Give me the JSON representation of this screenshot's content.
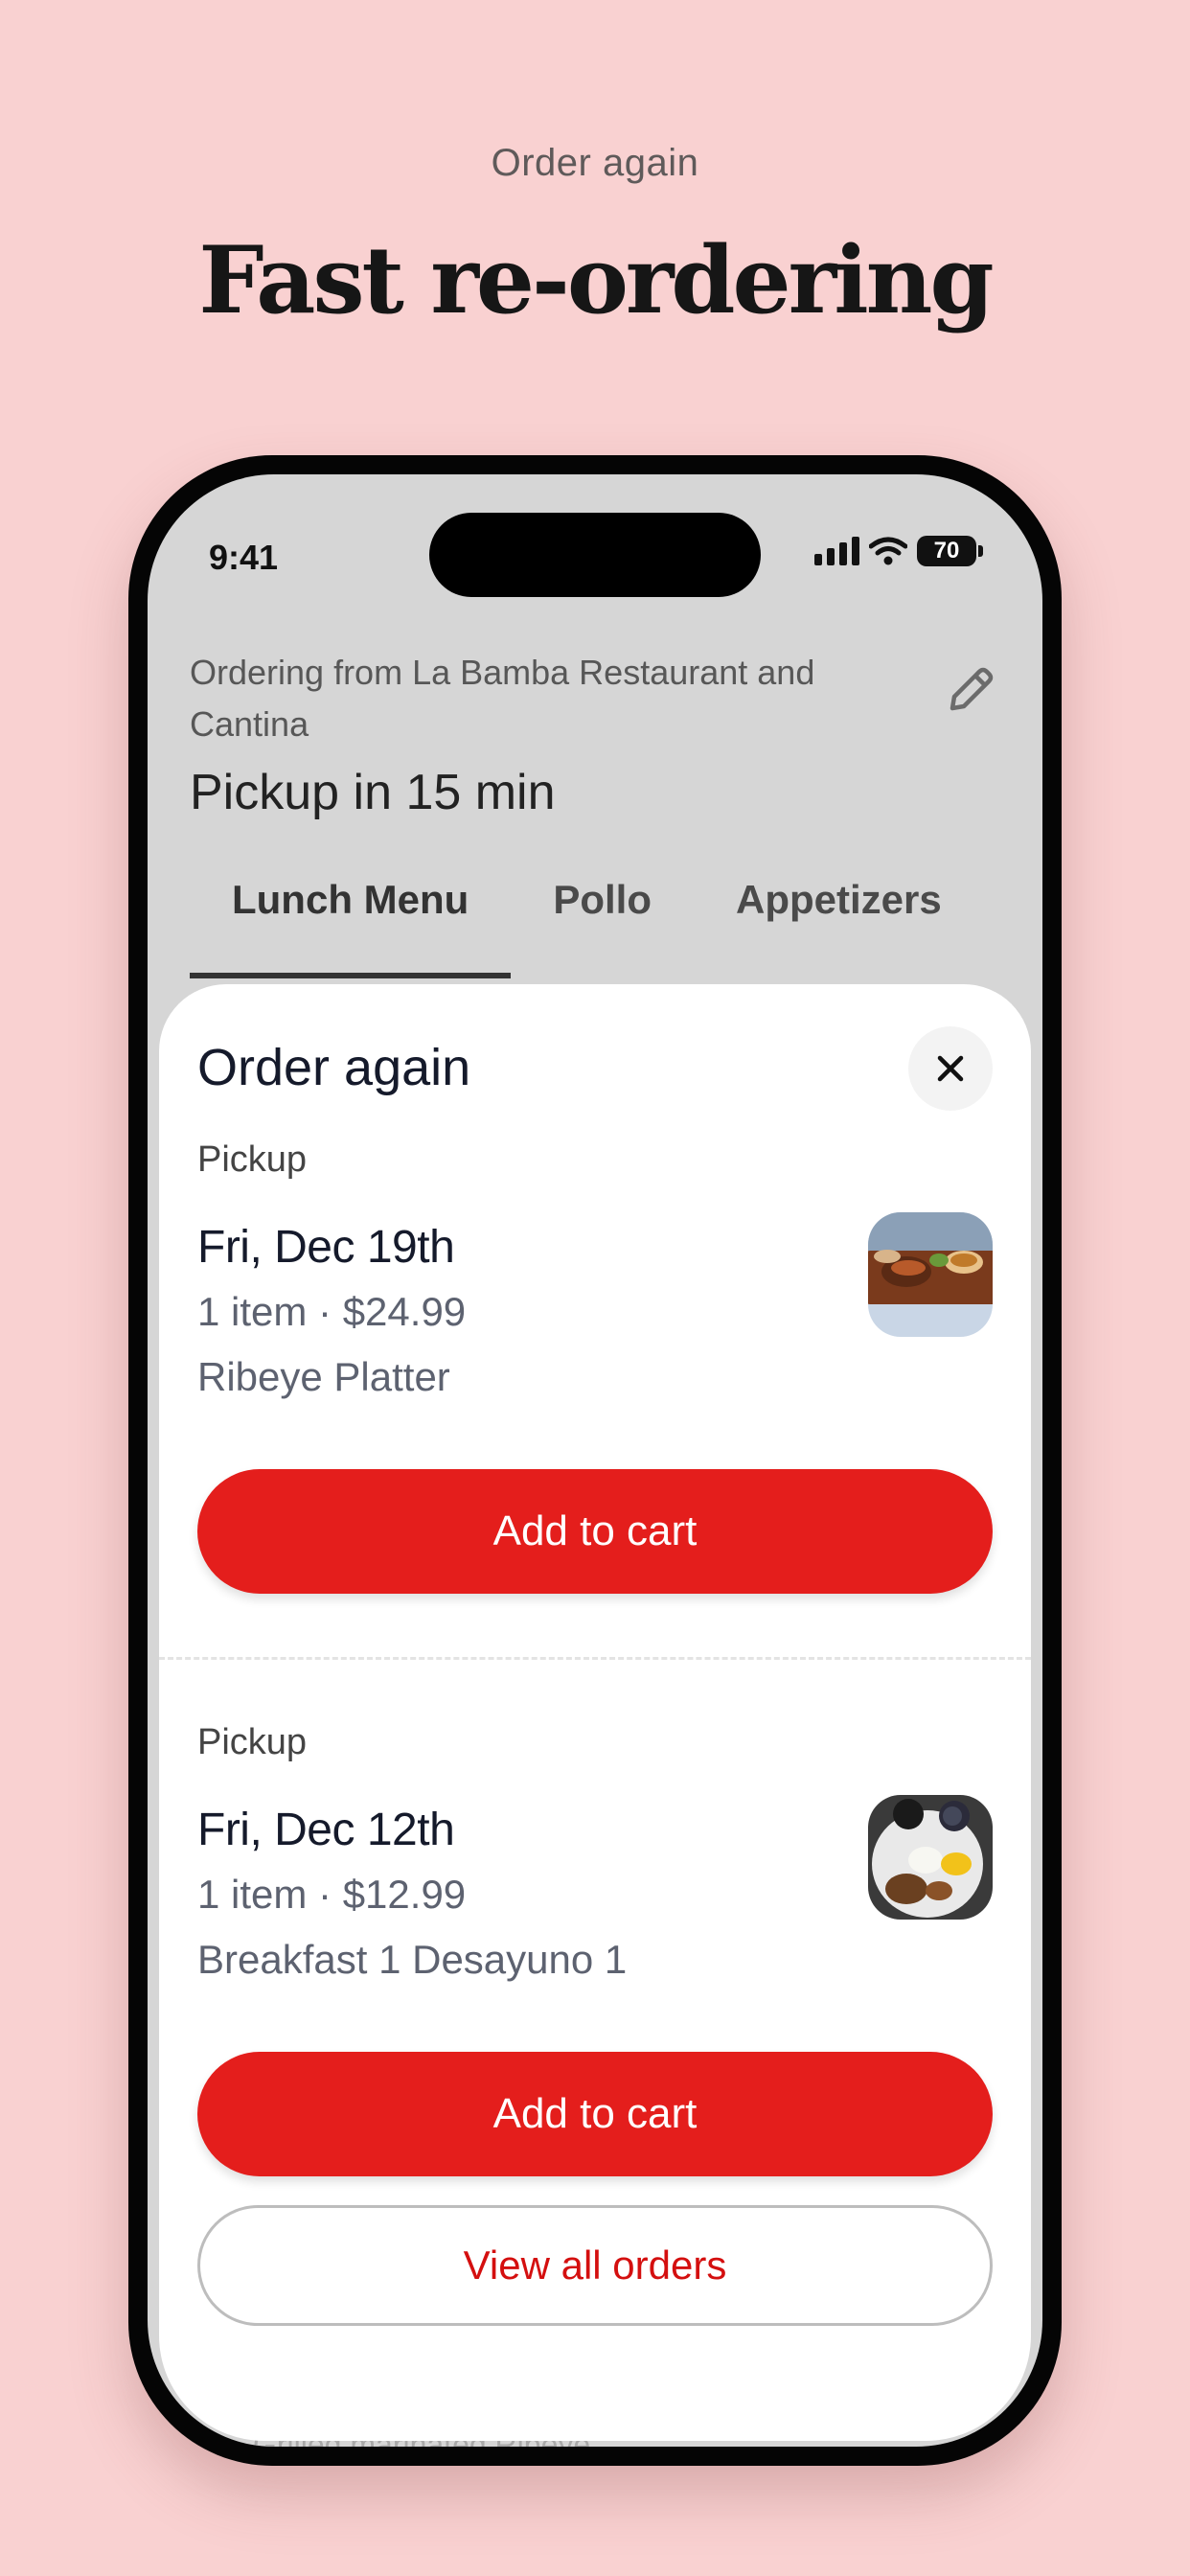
{
  "promo": {
    "eyebrow": "Order again",
    "headline": "Fast re-ordering"
  },
  "status_bar": {
    "time": "9:41",
    "battery": "70",
    "icons": [
      "signal-icon",
      "wifi-icon",
      "battery-icon"
    ]
  },
  "header": {
    "ordering_from": "Ordering from La Bamba Restaurant and Cantina",
    "pickup_time": "Pickup in 15 min",
    "edit_icon": "pencil-icon"
  },
  "tabs": [
    {
      "label": "Lunch Menu",
      "active": true
    },
    {
      "label": "Pollo",
      "active": false
    },
    {
      "label": "Appetizers",
      "active": false
    }
  ],
  "background_peek": "Grilled marinated Ribeye",
  "sheet": {
    "title": "Order again",
    "close_icon": "close-icon",
    "orders": [
      {
        "type": "Pickup",
        "date": "Fri, Dec 19th",
        "meta": "1 item · $24.99",
        "item": "Ribeye Platter",
        "button": "Add to cart"
      },
      {
        "type": "Pickup",
        "date": "Fri, Dec 12th",
        "meta": "1 item · $12.99",
        "item": "Breakfast 1 Desayuno 1",
        "button": "Add to cart"
      }
    ],
    "view_all": "View all orders"
  },
  "colors": {
    "background": "#f9d1d1",
    "accent_red": "#e41e1c",
    "link_red": "#d40f0f"
  }
}
